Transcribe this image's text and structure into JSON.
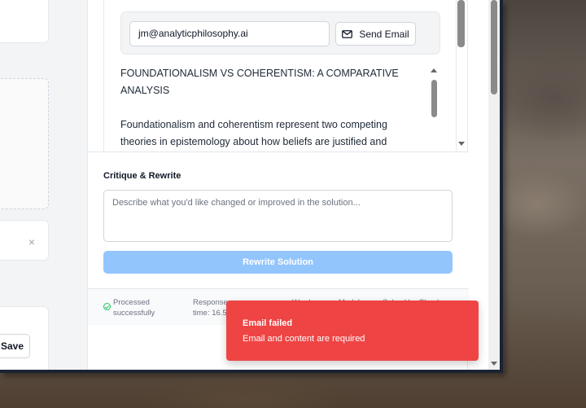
{
  "email": {
    "address": "jm@analyticphilosophy.ai",
    "send_label": "Send Email"
  },
  "document": {
    "paragraphs": [
      "FOUNDATIONALISM VS COHERENTISM: A COMPARATIVE ANALYSIS",
      "Foundationalism and coherentism represent two competing theories in epistemology about how beliefs are justified and"
    ]
  },
  "critique": {
    "label": "Critique & Rewrite",
    "placeholder": "Describe what you'd like changed or improved in the solution...",
    "button_label": "Rewrite Solution"
  },
  "status": {
    "processed": "Processed successfully",
    "response": "Response time: 16.5s",
    "words": "Words",
    "model": "Model",
    "solved": "Solved by Claude"
  },
  "left": {
    "save_label": "Save",
    "close_symbol": "×"
  },
  "toast": {
    "title": "Email failed",
    "message": "Email and content are required",
    "color": "#ef4444"
  },
  "icons": [
    "mail-icon",
    "check-circle-icon",
    "close-icon"
  ]
}
